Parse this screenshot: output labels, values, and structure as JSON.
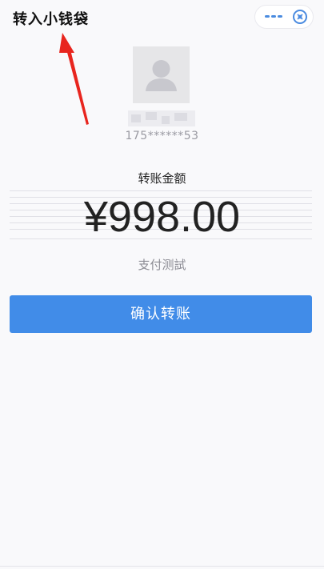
{
  "header": {
    "title": "转入小钱袋",
    "more_icon": "more-dots-icon",
    "close_icon": "close-target-icon"
  },
  "recipient": {
    "avatar_icon": "default-user-avatar-icon",
    "phone": "175******53"
  },
  "transfer": {
    "amount_label": "转账金额",
    "amount": "¥998.00",
    "note": "支付测試"
  },
  "actions": {
    "confirm_label": "确认转账"
  },
  "colors": {
    "accent": "#418ce8",
    "annotation_arrow": "#e8251e"
  }
}
